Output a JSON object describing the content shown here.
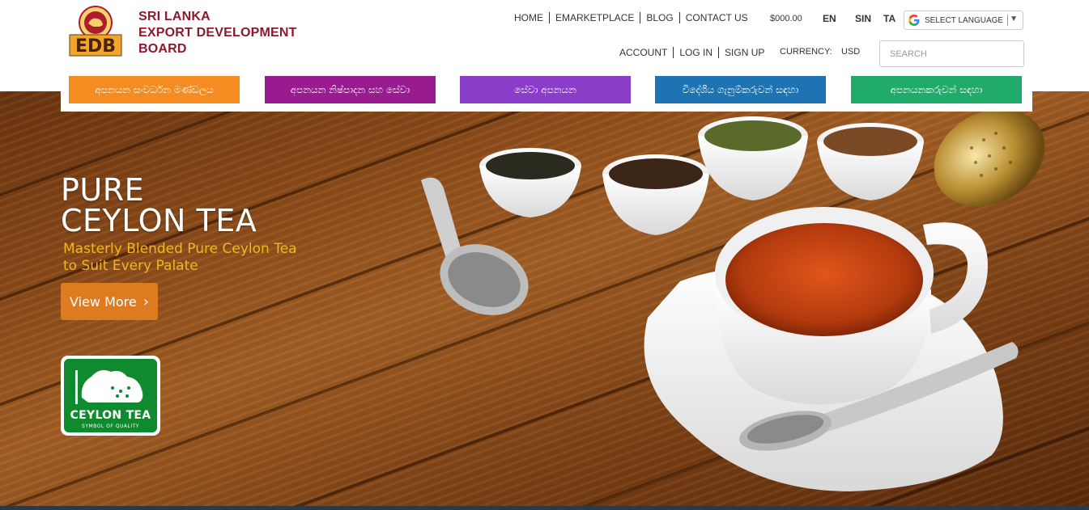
{
  "brand": {
    "line1": "SRI LANKA",
    "line2": "EXPORT DEVELOPMENT",
    "line3": "BOARD",
    "logo_text": "EDB"
  },
  "topnav": [
    {
      "label": "HOME"
    },
    {
      "label": "EMARKETPLACE"
    },
    {
      "label": "BLOG"
    },
    {
      "label": "CONTACT US"
    }
  ],
  "cart_total": "$000.00",
  "languages": {
    "en": "EN",
    "sin": "SIN",
    "ta": "TA"
  },
  "translate": {
    "label": "SELECT LANGUAGE",
    "arrow": "▼"
  },
  "account_nav": [
    {
      "label": "ACCOUNT"
    },
    {
      "label": "LOG IN"
    },
    {
      "label": "SIGN UP"
    }
  ],
  "currency": {
    "label": "CURRENCY:",
    "value": "USD"
  },
  "search": {
    "placeholder": "SEARCH"
  },
  "menu": [
    {
      "label": "අපනයන සංවර්ධන මණ්ඩලය",
      "color": "#f58c21"
    },
    {
      "label": "අපනයන නිෂ්පාදන සහ සේවා",
      "color": "#981b8f"
    },
    {
      "label": "සේවා අපනයන",
      "color": "#8a3dc9"
    },
    {
      "label": "විදේශීය ගැනුම්කරුවන් සඳහා",
      "color": "#1e73b3"
    },
    {
      "label": "අපනයනකරුවන් සඳහා",
      "color": "#21ab6b"
    }
  ],
  "hero": {
    "title_line1": "PURE",
    "title_line2": "CEYLON TEA",
    "subtitle_line1": "Masterly Blended Pure Ceylon Tea",
    "subtitle_line2": "to Suit Every Palate",
    "button_label": "View More",
    "badge_label": "CEYLON TEA",
    "badge_small": "SYMBOL OF QUALITY"
  }
}
